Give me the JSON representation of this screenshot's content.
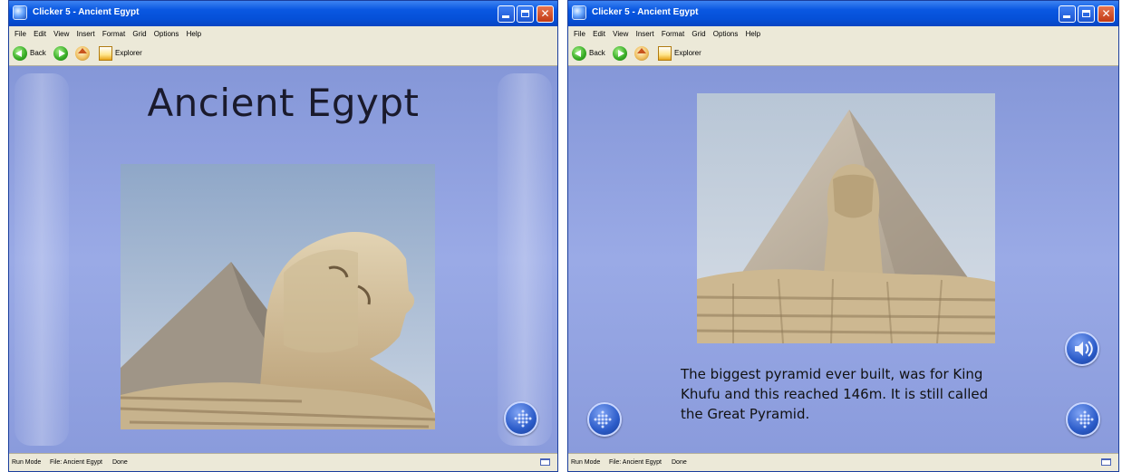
{
  "left_window": {
    "title": "Clicker 5 - Ancient Egypt",
    "menu": [
      "File",
      "Edit",
      "View",
      "Insert",
      "Format",
      "Grid",
      "Options",
      "Help"
    ],
    "toolbar": {
      "back_label": "Back",
      "explorer_label": "Explorer"
    },
    "page_title": "Ancient Egypt",
    "status": {
      "mode": "Run Mode",
      "file": "File: Ancient Egypt",
      "state": "Done"
    }
  },
  "right_window": {
    "title": "Clicker 5 - Ancient Egypt",
    "menu": [
      "File",
      "Edit",
      "View",
      "Insert",
      "Format",
      "Grid",
      "Options",
      "Help"
    ],
    "toolbar": {
      "back_label": "Back",
      "explorer_label": "Explorer"
    },
    "caption_lines": [
      "The biggest pyramid ever built, was for King",
      "Khufu and this reached 146m.  It is still called",
      "the Great Pyramid."
    ],
    "status": {
      "mode": "Run Mode",
      "file": "File: Ancient Egypt",
      "state": "Done"
    }
  },
  "colors": {
    "titlebar": "#0a58e2",
    "content_bg": "#8ea2e0",
    "menubar_bg": "#ece9d8",
    "button_blue": "#2c5cc9"
  },
  "icons": [
    "app-icon",
    "back-icon",
    "forward-icon",
    "home-icon",
    "explorer-icon",
    "minimize-icon",
    "maximize-icon",
    "close-icon",
    "next-page-icon",
    "previous-page-icon",
    "speaker-icon"
  ]
}
